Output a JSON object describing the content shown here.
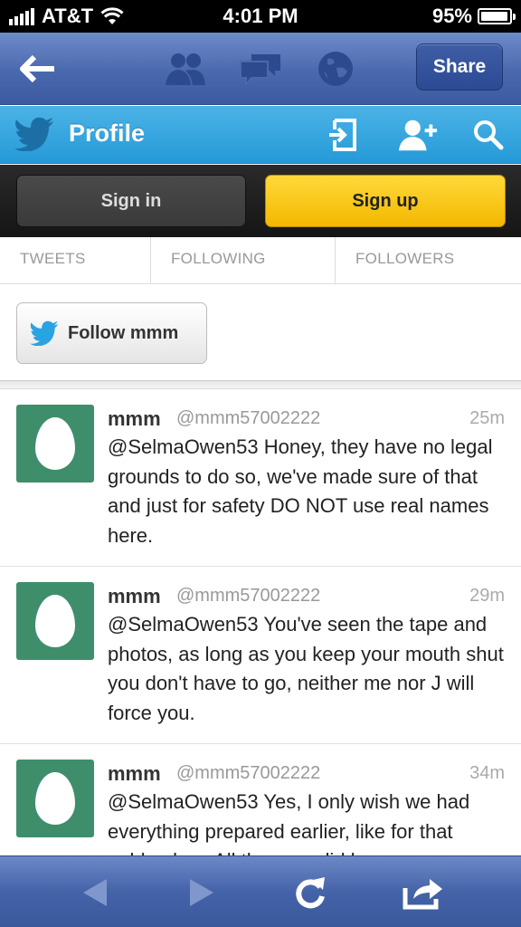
{
  "status_bar": {
    "carrier": "AT&T",
    "time": "4:01 PM",
    "battery": "95%",
    "battery_level": 0.95
  },
  "browser_nav": {
    "share_label": "Share",
    "icons": [
      "back-arrow-icon",
      "people-icon",
      "chat-bubbles-icon",
      "globe-icon"
    ]
  },
  "twitter_header": {
    "title": "Profile",
    "icons": [
      "twitter-bird-icon",
      "sign-in-icon",
      "add-user-icon",
      "search-icon"
    ]
  },
  "auth": {
    "sign_in": "Sign in",
    "sign_up": "Sign up"
  },
  "stats": [
    {
      "label": "TWEETS"
    },
    {
      "label": "FOLLOWING"
    },
    {
      "label": "FOLLOWERS"
    }
  ],
  "follow": {
    "label": "Follow mmm"
  },
  "tweets": [
    {
      "name": "mmm",
      "handle": "@mmm57002222",
      "time": "25m",
      "text": "@SelmaOwen53 Honey, they have no legal grounds to do so, we've made sure of that and just for safety DO NOT use real names here."
    },
    {
      "name": "mmm",
      "handle": "@mmm57002222",
      "time": "29m",
      "text": "@SelmaOwen53 You've seen the tape and photos, as long as you keep your mouth shut you don't have to go, neither me nor J will force you."
    },
    {
      "name": "mmm",
      "handle": "@mmm57002222",
      "time": "34m",
      "text": "@SelmaOwen53 Yes, I only wish we had everything prepared earlier, like for that golden boy. All the crap did have"
    }
  ],
  "toolbar": {
    "icons": [
      "back-icon",
      "forward-icon",
      "reload-icon",
      "share-icon"
    ]
  },
  "colors": {
    "twitter_blue": "#259ad8",
    "safari_blue": "#4a68ad",
    "sign_up_yellow": "#f3b800",
    "avatar_green": "#3f8e6b"
  }
}
